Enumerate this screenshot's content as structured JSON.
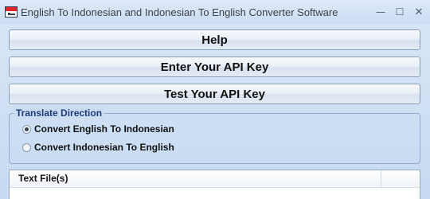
{
  "window": {
    "title": "English To Indonesian and Indonesian To English Converter Software",
    "icon": "indonesia-flag-window-icon",
    "controls": {
      "minimize": "—",
      "maximize": "☐",
      "close": "✕"
    }
  },
  "buttons": {
    "help": "Help",
    "enter_api_key": "Enter Your API Key",
    "test_api_key": "Test Your API Key"
  },
  "translate_direction": {
    "label": "Translate Direction",
    "options": [
      {
        "label": "Convert English To Indonesian",
        "selected": true
      },
      {
        "label": "Convert Indonesian To English",
        "selected": false
      }
    ]
  },
  "file_list": {
    "columns": [
      "Text File(s)",
      ""
    ]
  },
  "colors": {
    "group_label": "#1e3b78",
    "window_bg": "#cfe0f4",
    "flag_red": "#e3262c"
  }
}
